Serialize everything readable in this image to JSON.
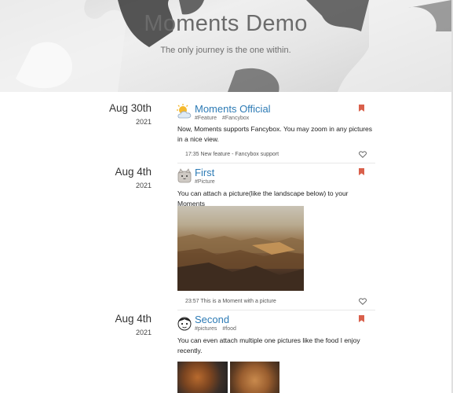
{
  "header": {
    "title": "Moments Demo",
    "subtitle": "The only journey is the one within."
  },
  "colors": {
    "link": "#2d7bb5",
    "bookmark": "#d9604b"
  },
  "moments": [
    {
      "date": "Aug 30th",
      "year": "2021",
      "avatar_icon": "weather-sun-cloud-icon",
      "title": "Moments Official",
      "tags": [
        "#Feature",
        "#Fancybox"
      ],
      "text": "Now, Moments supports Fancybox. You may zoom in any pictures in a nice view.",
      "meta": "17:35 New feature - Fancybox support"
    },
    {
      "date": "Aug 4th",
      "year": "2021",
      "avatar_icon": "cat-avatar-icon",
      "title": "First",
      "tags": [
        "#Picture"
      ],
      "text": "You can attach a picture(like the landscape below) to your Moments",
      "meta": "23:57 This is a Moment with a picture"
    },
    {
      "date": "Aug 4th",
      "year": "2021",
      "avatar_icon": "cartoon-face-avatar-icon",
      "title": "Second",
      "tags": [
        "#pictures",
        "#food"
      ],
      "text": "You can even attach multiple one pictures like the food I enjoy recently."
    }
  ]
}
